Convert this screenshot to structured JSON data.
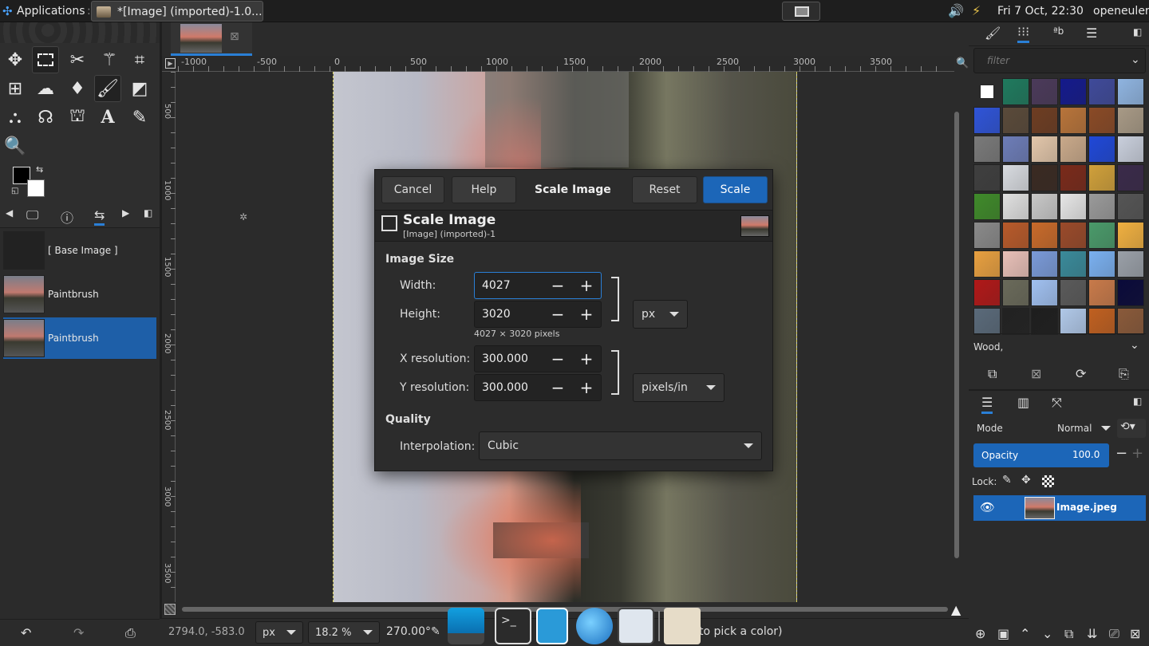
{
  "topbar": {
    "apps_label": "Applications",
    "apps_sep": ":",
    "task_title": "*[Image] (imported)-1.0...",
    "datetime": "Fri  7 Oct, 22:30",
    "user": "openeuler"
  },
  "history": {
    "items": [
      {
        "label": "[ Base Image ]"
      },
      {
        "label": "Paintbrush"
      },
      {
        "label": "Paintbrush"
      }
    ]
  },
  "ruler": {
    "h_ticks": [
      "-1000",
      "-500",
      "0",
      "500",
      "1000",
      "1500",
      "2000",
      "2500",
      "3000",
      "3500"
    ],
    "v_ticks": [
      "500",
      "1000",
      "1500",
      "2000",
      "2500",
      "3000",
      "3500"
    ]
  },
  "dialog": {
    "cancel": "Cancel",
    "help": "Help",
    "title_tab": "Scale Image",
    "reset": "Reset",
    "scale": "Scale",
    "header_title": "Scale Image",
    "header_sub": "[Image] (imported)-1",
    "image_size_heading": "Image Size",
    "width_label": "Width:",
    "width_value": "4027",
    "height_label": "Height:",
    "height_value": "3020",
    "size_note": "4027 × 3020 pixels",
    "unit": "px",
    "xres_label": "X resolution:",
    "xres_value": "300.000",
    "yres_label": "Y resolution:",
    "yres_value": "300.000",
    "res_unit": "pixels/in",
    "quality_heading": "Quality",
    "interp_label": "Interpolation:",
    "interp_value": "Cubic",
    "minus": "−",
    "plus": "+"
  },
  "patterns": {
    "filter_placeholder": "filter",
    "selected_name": "Wood,",
    "colors": [
      "#ffffff",
      "#1f7a5e",
      "#4b3a5a",
      "#141a8c",
      "#3f4a9a",
      "#8fb4e0",
      "#2f54d8",
      "#5a4a3a",
      "#6e3d22",
      "#b8743a",
      "#8a4a26",
      "#a89a86",
      "#7a7a7a",
      "#6d7db8",
      "#e2c6aa",
      "#c9a98a",
      "#1f48d8",
      "#c9cfdc",
      "#3f3f3f",
      "#d8dbe0",
      "#3a2a22",
      "#7a2a1a",
      "#d0a03a",
      "#3a2a4a",
      "#3f8a2a",
      "#e0e0e0",
      "#c8c8c8",
      "#e6e6e6",
      "#9a9a9a",
      "#555555",
      "#8a8a8a",
      "#b85a2a",
      "#c86a2a",
      "#9a4a2a",
      "#4a9a6a",
      "#f0b040",
      "#e8a040",
      "#e8c0b8",
      "#7a9ad8",
      "#3a8a9a",
      "#7ab0f0",
      "#9aa0a8",
      "#b01818",
      "#6a6a5a",
      "#a0c0f0",
      "#5a5a5a",
      "#c87a4a",
      "#0a0a3a",
      "#5a6a7a",
      "#222222",
      "#1e1e1e",
      "#b0c8e8",
      "#c06020",
      "#8a5a3a"
    ]
  },
  "layers": {
    "mode_label": "Mode",
    "mode_value": "Normal",
    "opacity_label": "Opacity",
    "opacity_value": "100.0",
    "lock_label": "Lock:",
    "layer_name": "Image.jpeg"
  },
  "status": {
    "coords": "2794.0, -583.0",
    "unit": "px",
    "zoom": "18.2 %",
    "rotation": "270.00°",
    "message": "to pick a color)"
  }
}
